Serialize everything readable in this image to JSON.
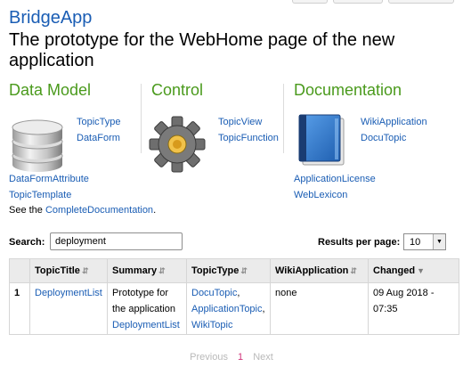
{
  "header": {
    "app_name": "BridgeApp",
    "description": "The prototype for the WebHome page of the new application"
  },
  "sections": {
    "data_model": {
      "title": "Data Model",
      "icon": "database-icon",
      "links_right": [
        "TopicType",
        "DataForm"
      ],
      "links_below": [
        "DataFormAttribute",
        "TopicTemplate"
      ]
    },
    "control": {
      "title": "Control",
      "icon": "gear-icon",
      "links_right": [
        "TopicView",
        "TopicFunction"
      ]
    },
    "documentation": {
      "title": "Documentation",
      "icon": "book-icon",
      "links_right": [
        "WikiApplication",
        "DocuTopic"
      ],
      "links_below": [
        "ApplicationLicense",
        "WebLexicon"
      ]
    }
  },
  "see_also": {
    "prefix": "See the",
    "link": "CompleteDocumentation",
    "suffix": "."
  },
  "search": {
    "label": "Search:",
    "value": "deployment"
  },
  "results_per_page": {
    "label": "Results per page:",
    "value": "10"
  },
  "table": {
    "headers": [
      "",
      "TopicTitle",
      "Summary",
      "TopicType",
      "WikiApplication",
      "Changed"
    ],
    "rows": [
      {
        "index": "1",
        "title": "DeploymentList",
        "summary_line1": "Prototype for",
        "summary_line2": "the application",
        "summary_link": "DeploymentList",
        "types": [
          "DocuTopic",
          "ApplicationTopic",
          "WikiTopic"
        ],
        "type_sep": ",",
        "wiki_app": "none",
        "changed": "09 Aug 2018 - 07:35"
      }
    ]
  },
  "pager": {
    "previous": "Previous",
    "current": "1",
    "next": "Next"
  },
  "colors": {
    "link": "#1a5db4",
    "section_title": "#4a9a1c",
    "pager_current": "#d0347a"
  }
}
